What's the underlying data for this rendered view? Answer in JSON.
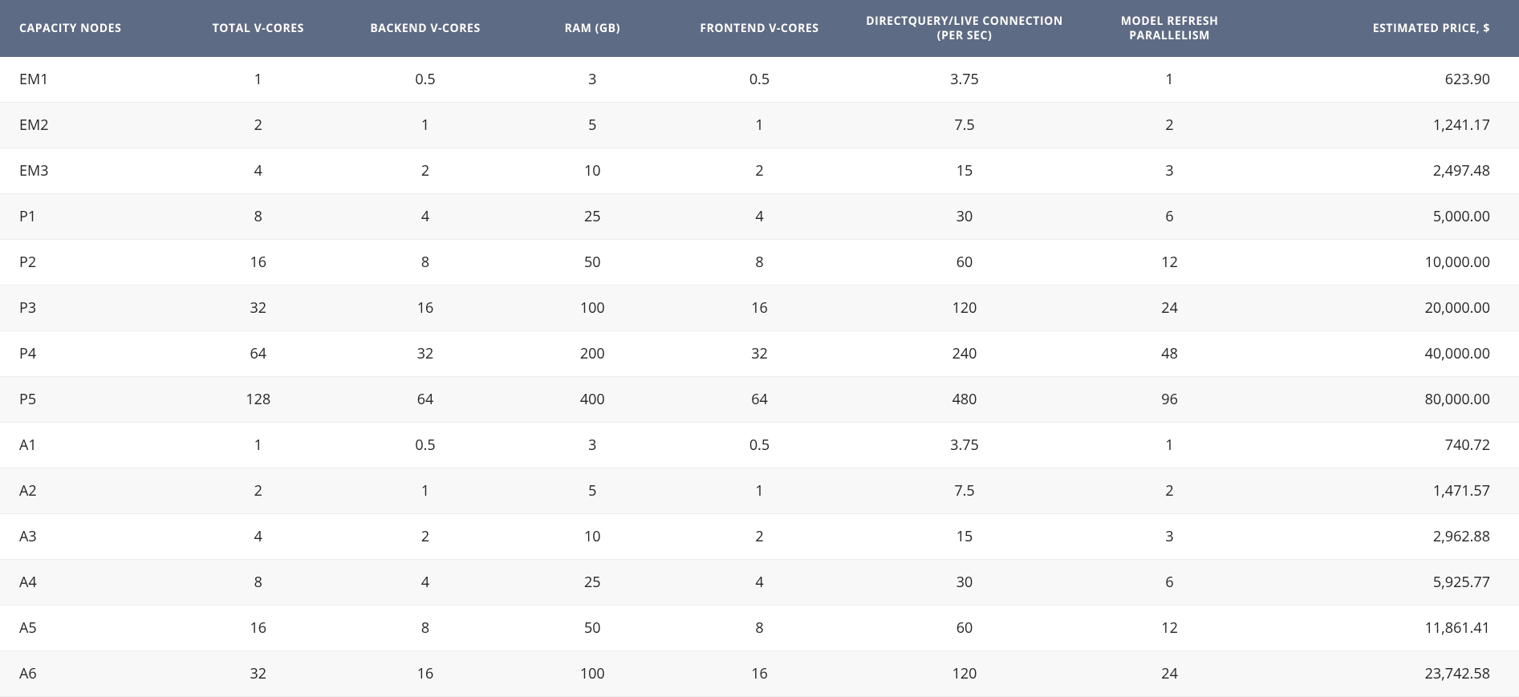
{
  "table": {
    "headers": [
      "CAPACITY NODES",
      "TOTAL V-CORES",
      "BACKEND V-CORES",
      "RAM (GB)",
      "FRONTEND\nV-CORES",
      "DIRECTQUERY/LIVE CONNECTION (PER SEC)",
      "MODEL REFRESH PARALLELISM",
      "ESTIMATED PRICE, $"
    ],
    "rows": [
      {
        "node": "EM1",
        "total": "1",
        "backend": "0.5",
        "ram": "3",
        "frontend": "0.5",
        "dqlive": "3.75",
        "refresh": "1",
        "price": "623.90"
      },
      {
        "node": "EM2",
        "total": "2",
        "backend": "1",
        "ram": "5",
        "frontend": "1",
        "dqlive": "7.5",
        "refresh": "2",
        "price": "1,241.17"
      },
      {
        "node": "EM3",
        "total": "4",
        "backend": "2",
        "ram": "10",
        "frontend": "2",
        "dqlive": "15",
        "refresh": "3",
        "price": "2,497.48"
      },
      {
        "node": "P1",
        "total": "8",
        "backend": "4",
        "ram": "25",
        "frontend": "4",
        "dqlive": "30",
        "refresh": "6",
        "price": "5,000.00"
      },
      {
        "node": "P2",
        "total": "16",
        "backend": "8",
        "ram": "50",
        "frontend": "8",
        "dqlive": "60",
        "refresh": "12",
        "price": "10,000.00"
      },
      {
        "node": "P3",
        "total": "32",
        "backend": "16",
        "ram": "100",
        "frontend": "16",
        "dqlive": "120",
        "refresh": "24",
        "price": "20,000.00"
      },
      {
        "node": "P4",
        "total": "64",
        "backend": "32",
        "ram": "200",
        "frontend": "32",
        "dqlive": "240",
        "refresh": "48",
        "price": "40,000.00"
      },
      {
        "node": "P5",
        "total": "128",
        "backend": "64",
        "ram": "400",
        "frontend": "64",
        "dqlive": "480",
        "refresh": "96",
        "price": "80,000.00"
      },
      {
        "node": "A1",
        "total": "1",
        "backend": "0.5",
        "ram": "3",
        "frontend": "0.5",
        "dqlive": "3.75",
        "refresh": "1",
        "price": "740.72"
      },
      {
        "node": "A2",
        "total": "2",
        "backend": "1",
        "ram": "5",
        "frontend": "1",
        "dqlive": "7.5",
        "refresh": "2",
        "price": "1,471.57"
      },
      {
        "node": "A3",
        "total": "4",
        "backend": "2",
        "ram": "10",
        "frontend": "2",
        "dqlive": "15",
        "refresh": "3",
        "price": "2,962.88"
      },
      {
        "node": "A4",
        "total": "8",
        "backend": "4",
        "ram": "25",
        "frontend": "4",
        "dqlive": "30",
        "refresh": "6",
        "price": "5,925.77"
      },
      {
        "node": "A5",
        "total": "16",
        "backend": "8",
        "ram": "50",
        "frontend": "8",
        "dqlive": "60",
        "refresh": "12",
        "price": "11,861.41"
      },
      {
        "node": "A6",
        "total": "32",
        "backend": "16",
        "ram": "100",
        "frontend": "16",
        "dqlive": "120",
        "refresh": "24",
        "price": "23,742.58"
      }
    ]
  }
}
